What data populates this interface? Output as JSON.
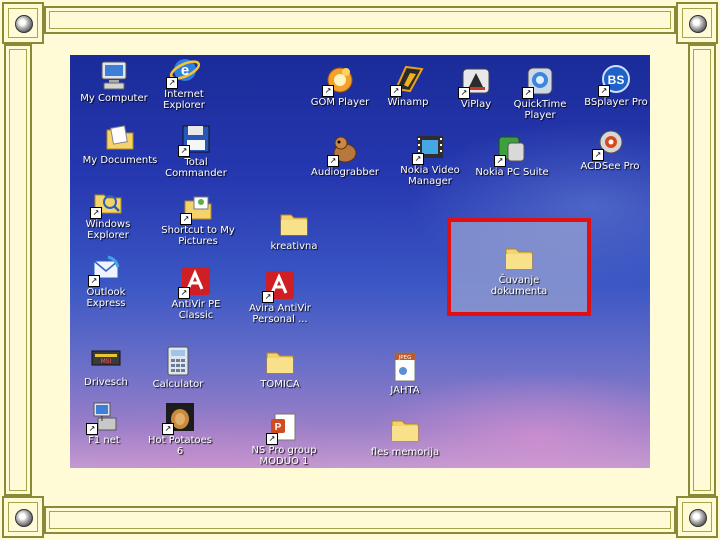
{
  "desktop": {
    "icons": [
      {
        "label": "My Computer",
        "icon": "computer-icon"
      },
      {
        "label": "Internet\nExplorer",
        "icon": "ie-icon"
      },
      {
        "label": "GOM Player",
        "icon": "gom-icon"
      },
      {
        "label": "Winamp",
        "icon": "winamp-icon"
      },
      {
        "label": "ViPlay",
        "icon": "viplay-icon"
      },
      {
        "label": "QuickTime\nPlayer",
        "icon": "quicktime-icon"
      },
      {
        "label": "BSplayer Pro",
        "icon": "bsplayer-icon"
      },
      {
        "label": "My Documents",
        "icon": "documents-icon"
      },
      {
        "label": "Total\nCommander",
        "icon": "floppy-icon"
      },
      {
        "label": "Audiograbber",
        "icon": "dog-icon"
      },
      {
        "label": "Nokia Video\nManager",
        "icon": "film-icon"
      },
      {
        "label": "Nokia PC Suite",
        "icon": "pcsuite-icon"
      },
      {
        "label": "ACDSee Pro",
        "icon": "acdsee-icon"
      },
      {
        "label": "Windows\nExplorer",
        "icon": "explorer-icon"
      },
      {
        "label": "Shortcut to My\nPictures",
        "icon": "pictures-icon"
      },
      {
        "label": "kreativna",
        "icon": "folder-icon"
      },
      {
        "label": "Čuvanje\ndokumenta",
        "icon": "folder-icon"
      },
      {
        "label": "Outlook\nExpress",
        "icon": "outlook-icon"
      },
      {
        "label": "AntiVir PE\nClassic",
        "icon": "antivir-icon"
      },
      {
        "label": "Avira AntiVir\nPersonal ...",
        "icon": "antivir-icon"
      },
      {
        "label": "Drivesch",
        "icon": "drive-icon"
      },
      {
        "label": "Calculator",
        "icon": "calculator-icon"
      },
      {
        "label": "TOMICA",
        "icon": "folder-icon"
      },
      {
        "label": "JAHTA",
        "icon": "jpeg-icon"
      },
      {
        "label": "F1 net",
        "icon": "network-icon"
      },
      {
        "label": "Hot Potatoes\n6",
        "icon": "potatoes-icon"
      },
      {
        "label": "NS Pro group\nMODUO 1",
        "icon": "powerpoint-icon"
      },
      {
        "label": "fles memorija",
        "icon": "folder-icon"
      }
    ]
  },
  "colors": {
    "frame": "#fffbd6",
    "frame_border": "#8a8a36",
    "selection_border": "#e01010"
  }
}
